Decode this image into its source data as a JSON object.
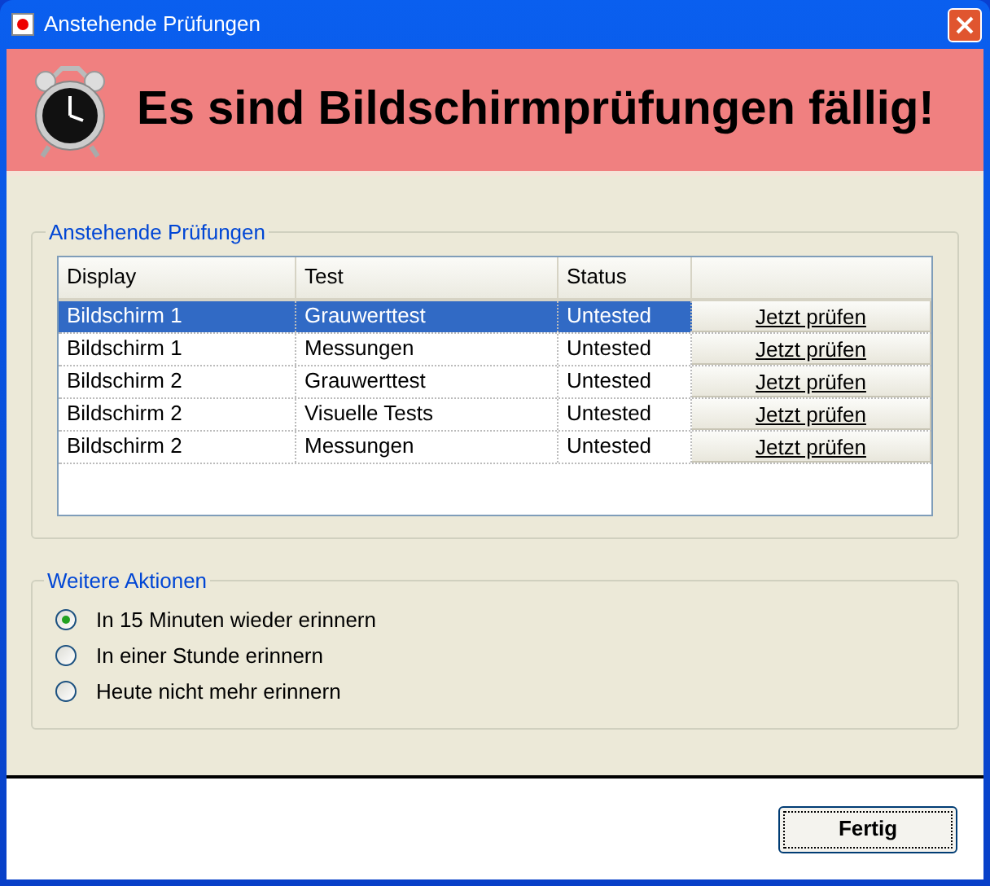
{
  "window": {
    "title": "Anstehende Prüfungen"
  },
  "banner": {
    "headline": "Es sind Bildschirmprüfungen fällig!"
  },
  "pending": {
    "title": "Anstehende Prüfungen",
    "columns": [
      "Display",
      "Test",
      "Status"
    ],
    "rows": [
      {
        "display": "Bildschirm 1",
        "test": "Grauwerttest",
        "status": "Untested",
        "action": "Jetzt prüfen",
        "selected": true
      },
      {
        "display": "Bildschirm 1",
        "test": "Messungen",
        "status": "Untested",
        "action": "Jetzt prüfen",
        "selected": false
      },
      {
        "display": "Bildschirm 2",
        "test": "Grauwerttest",
        "status": "Untested",
        "action": "Jetzt prüfen",
        "selected": false
      },
      {
        "display": "Bildschirm 2",
        "test": "Visuelle Tests",
        "status": "Untested",
        "action": "Jetzt prüfen",
        "selected": false
      },
      {
        "display": "Bildschirm 2",
        "test": "Messungen",
        "status": "Untested",
        "action": "Jetzt prüfen",
        "selected": false
      }
    ]
  },
  "more_actions": {
    "title": "Weitere Aktionen",
    "options": [
      {
        "label": "In 15 Minuten wieder erinnern",
        "selected": true
      },
      {
        "label": "In einer Stunde erinnern",
        "selected": false
      },
      {
        "label": "Heute nicht mehr erinnern",
        "selected": false
      }
    ]
  },
  "buttons": [
    "Fertig"
  ]
}
